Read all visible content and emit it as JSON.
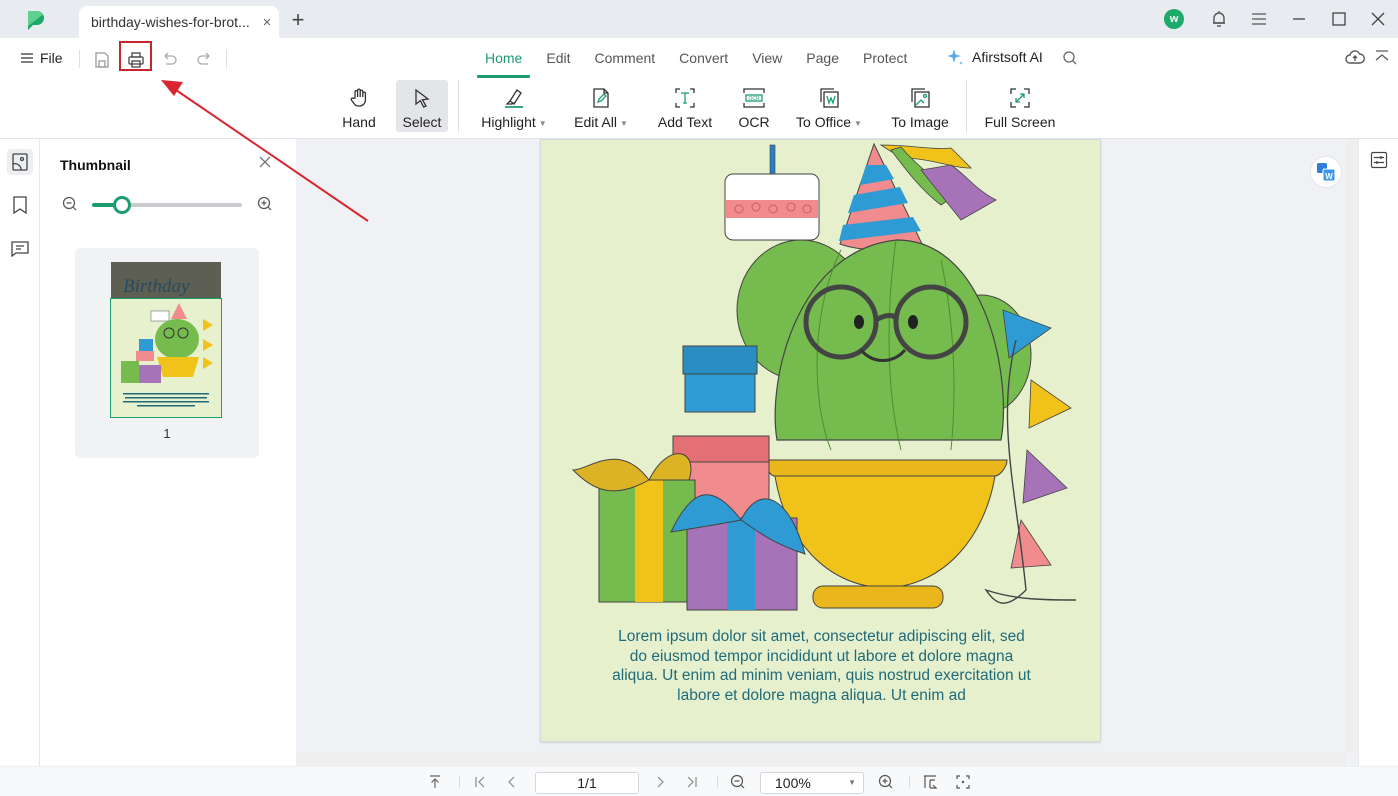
{
  "app": {
    "tab_title": "birthday-wishes-for-brot...",
    "tab_close": "×",
    "new_tab": "+",
    "avatar_letter": "w"
  },
  "toolbar": {
    "file_label": "File",
    "menu_tabs": [
      {
        "label": "Home",
        "active": true
      },
      {
        "label": "Edit"
      },
      {
        "label": "Comment"
      },
      {
        "label": "Convert"
      },
      {
        "label": "View"
      },
      {
        "label": "Page"
      },
      {
        "label": "Protect"
      }
    ],
    "ai_label": "Afirstsoft AI",
    "ribbon": [
      {
        "label": "Hand",
        "icon": "hand-icon"
      },
      {
        "label": "Select",
        "icon": "cursor-icon",
        "active": true
      },
      {
        "label": "Highlight",
        "icon": "highlighter-icon",
        "dropdown": true
      },
      {
        "label": "Edit All",
        "icon": "edit-document-icon",
        "dropdown": true
      },
      {
        "label": "Add Text",
        "icon": "add-text-icon"
      },
      {
        "label": "OCR",
        "icon": "ocr-icon"
      },
      {
        "label": "To Office",
        "icon": "to-office-icon",
        "dropdown": true
      },
      {
        "label": "To Image",
        "icon": "to-image-icon"
      },
      {
        "label": "Full Screen",
        "icon": "full-screen-icon"
      }
    ]
  },
  "thumbnail_panel": {
    "title": "Thumbnail",
    "zoom_level": 0.2,
    "pages": [
      {
        "label": "1",
        "thumb_title": "Birthday"
      }
    ]
  },
  "document": {
    "body_text": "Lorem ipsum dolor sit amet, consectetur adipiscing elit, sed do eiusmod tempor incididunt ut labore et dolore magna aliqua. Ut enim ad minim veniam, quis nostrud exercitation ut labore et dolore magna aliqua. Ut enim ad",
    "body_lines": [
      "Lorem ipsum dolor sit amet, consectetur adipiscing elit, sed",
      "do eiusmod tempor incididunt ut labore et dolore magna",
      "aliqua. Ut enim ad minim veniam, quis nostrud exercitation ut",
      "labore et dolore magna aliqua. Ut enim ad"
    ],
    "page_bg_color": "#e6f0cd",
    "text_color": "#1f6b7a"
  },
  "statusbar": {
    "page_value": "1/1",
    "zoom_value": "100%"
  },
  "colors": {
    "accent": "#1b9d6e",
    "annotation": "#d9252f"
  }
}
